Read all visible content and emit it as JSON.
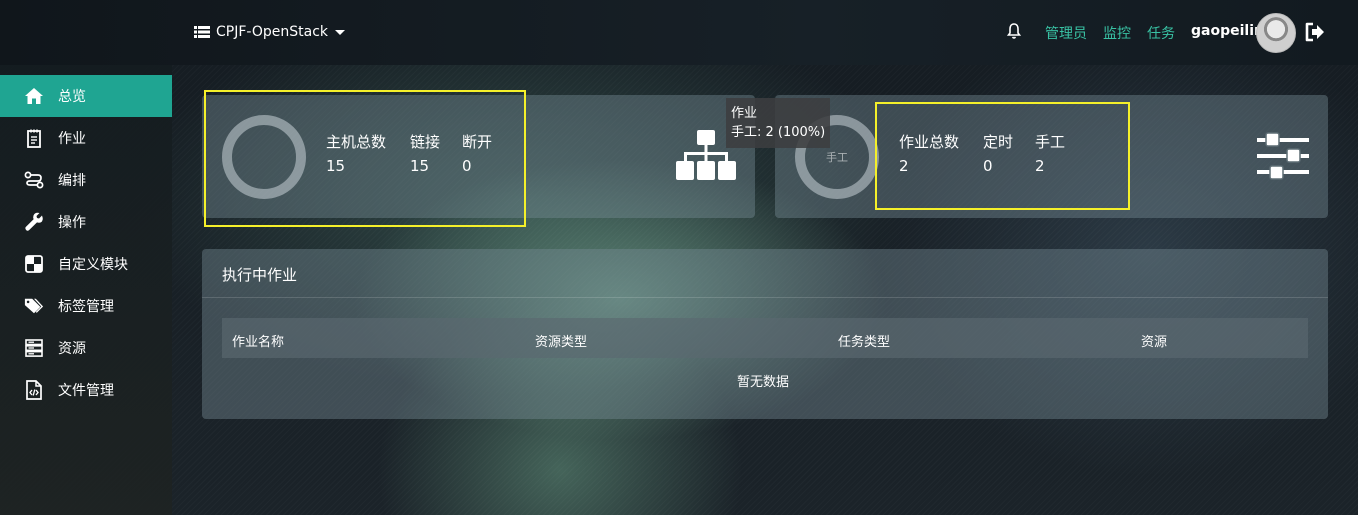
{
  "header": {
    "project": "CPJF-OpenStack",
    "links": [
      "管理员",
      "监控",
      "任务"
    ],
    "username": "gaopeilin",
    "accent_color": "#39c2a4"
  },
  "sidebar": {
    "active_color": "#1fa592",
    "items": [
      {
        "label": "总览",
        "icon": "home-icon",
        "active": true
      },
      {
        "label": "作业",
        "icon": "notebook-icon"
      },
      {
        "label": "编排",
        "icon": "route-icon"
      },
      {
        "label": "操作",
        "icon": "wrench-icon"
      },
      {
        "label": "自定义模块",
        "icon": "module-icon"
      },
      {
        "label": "标签管理",
        "icon": "tags-icon"
      },
      {
        "label": "资源",
        "icon": "server-icon"
      },
      {
        "label": "文件管理",
        "icon": "file-code-icon"
      }
    ]
  },
  "hosts_card": {
    "labels": [
      "主机总数",
      "链接",
      "断开"
    ],
    "values": [
      "15",
      "15",
      "0"
    ],
    "icon": "sitemap-icon"
  },
  "jobs_card": {
    "ring_label": "手工",
    "labels": [
      "作业总数",
      "定时",
      "手工"
    ],
    "values": [
      "2",
      "0",
      "2"
    ],
    "icon": "sliders-icon"
  },
  "tooltip": {
    "title": "作业",
    "text": "手工: 2 (100%)"
  },
  "running_panel": {
    "title": "执行中作业",
    "columns": [
      "作业名称",
      "资源类型",
      "任务类型",
      "资源"
    ],
    "empty_text": "暂无数据"
  }
}
